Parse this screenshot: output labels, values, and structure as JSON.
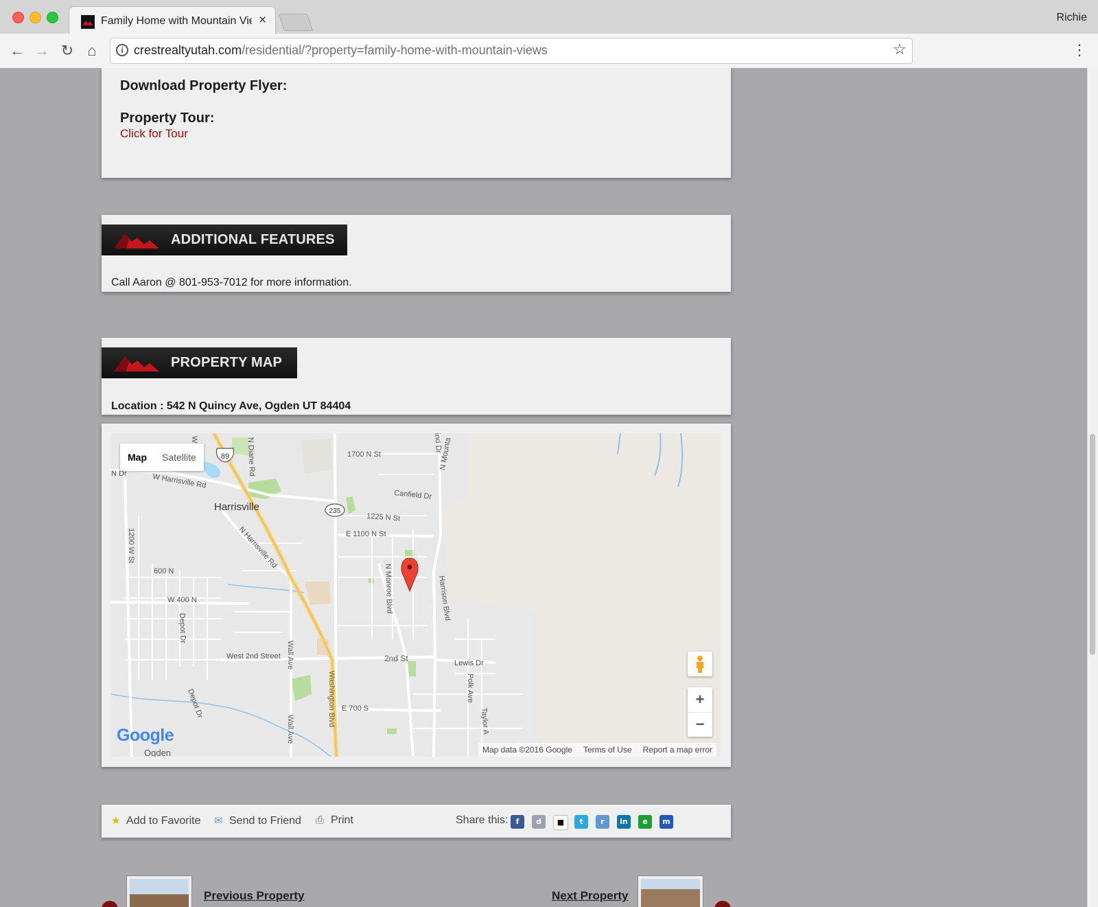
{
  "browser": {
    "tab_title": "Family Home with Mountain Views",
    "tab_close": "×",
    "profile_name": "Richie",
    "url_host": "crestrealtyutah.com",
    "url_path": "/residential/?property=family-home-with-mountain-views",
    "icons": {
      "back": "←",
      "forward": "→",
      "reload": "↻",
      "home": "⌂",
      "info": "i",
      "star": "☆",
      "menu": "⋮"
    }
  },
  "flyer": {
    "download_label": "Download Property Flyer:",
    "tour_label": "Property Tour:",
    "tour_link": "Click for Tour"
  },
  "features": {
    "title": "ADDITIONAL FEATURES",
    "text": "Call Aaron @ 801-953-7012 for more information."
  },
  "property_map": {
    "title": "PROPERTY MAP",
    "location": "Location : 542 N Quincy Ave, Ogden UT 84404"
  },
  "map": {
    "type_map": "Map",
    "type_satellite": "Satellite",
    "zoom_in": "+",
    "zoom_out": "−",
    "attribution": "Map data ©2016 Google",
    "terms": "Terms of Use",
    "report": "Report a map error",
    "logo": "Google",
    "labels": {
      "harrisville": "Harrisville",
      "w_harrisville_rd": "W Harrisville Rd",
      "n_harrisville_rd": "N Harrisville Rd",
      "n_diane_rd": "N Diane Rd",
      "n_1700": "1700 N St",
      "canfield": "Canfield Dr",
      "n_1225": "1225 N St",
      "e_1100": "E 1100 N St",
      "w_1200": "1200 W St",
      "n_600": "600 N",
      "w_400": "W 400 N",
      "depot_dr": "Depot Dr",
      "depot_dr_2": "Depot Dr",
      "west_2nd": "West 2nd Street",
      "wall_ave": "Wall Ave",
      "wall_ave_2": "Wall Ave",
      "washington": "Washington Blvd",
      "monroe": "N Monroe Blvd",
      "harrison": "Harrison Blvd",
      "second_st": "2nd St",
      "lewis": "Lewis Dr",
      "polk": "Polk Ave",
      "taylor": "Taylor A",
      "e_700": "E 700 S",
      "n_mounta": "N Mounta",
      "ind_dr": "ind Dr",
      "w_dr": "N Dr",
      "w_corner": "W",
      "ogden": "Ogden",
      "us89": "89",
      "sr235": "235"
    }
  },
  "share": {
    "favorite": "Add to Favorite",
    "send": "Send to Friend",
    "print": "Print",
    "share_label": "Share this:",
    "services": [
      {
        "glyph": "f",
        "color": "#3b5998"
      },
      {
        "glyph": "d",
        "color": "#9aa3ad"
      },
      {
        "glyph": "■",
        "color": "#ffffff"
      },
      {
        "glyph": "t",
        "color": "#29a9e1"
      },
      {
        "glyph": "r",
        "color": "#5f99cf"
      },
      {
        "glyph": "in",
        "color": "#0e76a8"
      },
      {
        "glyph": "e",
        "color": "#1aa035"
      },
      {
        "glyph": "m",
        "color": "#1f5bbd"
      }
    ]
  },
  "pager": {
    "previous": "Previous Property",
    "next": "Next Property"
  },
  "colors": {
    "accent_red": "#a0100e",
    "page_bg": "#a9a8ab",
    "panel_bg": "#efefef",
    "header_bg": "#1b1b1b"
  }
}
